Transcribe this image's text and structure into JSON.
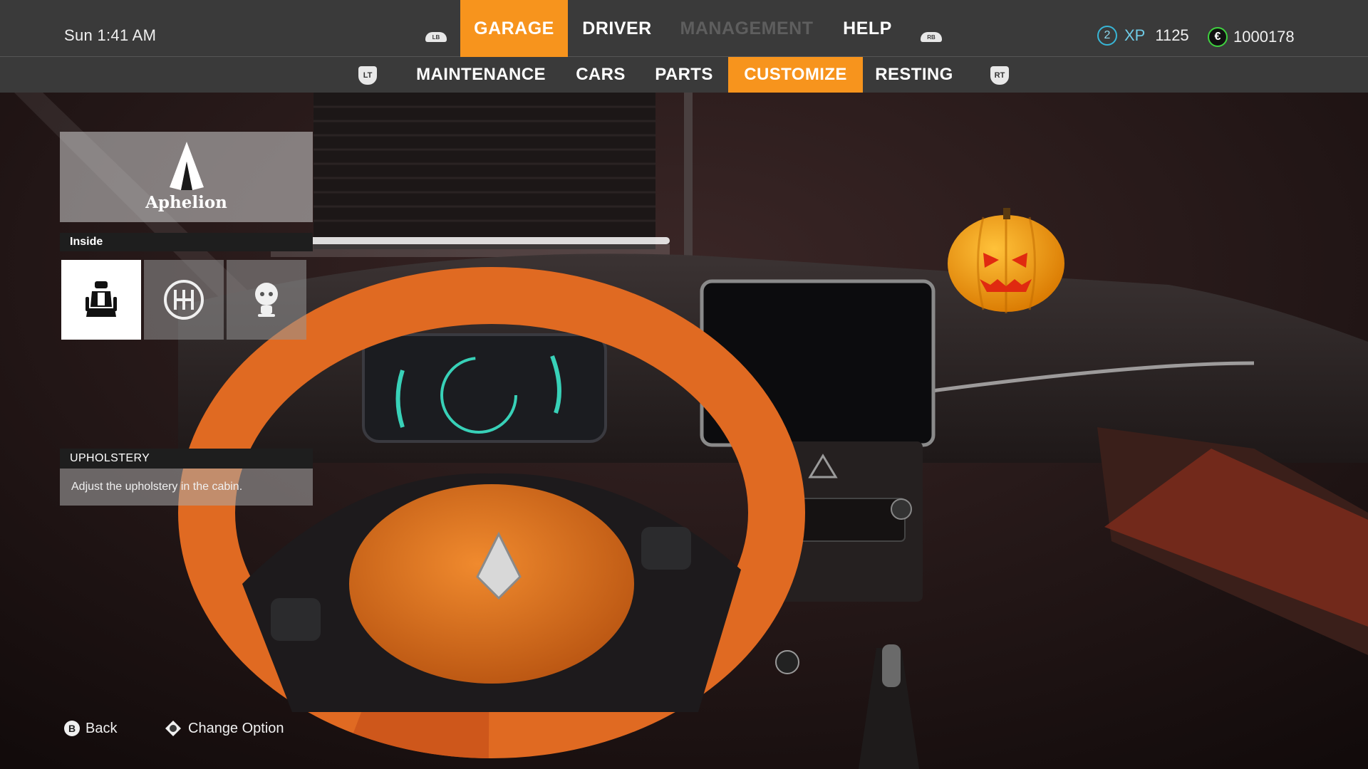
{
  "clock": "Sun  1:41 AM",
  "main_tabs": [
    {
      "label": "GARAGE",
      "state": "active"
    },
    {
      "label": "DRIVER",
      "state": "normal"
    },
    {
      "label": "MANAGEMENT",
      "state": "disabled"
    },
    {
      "label": "HELP",
      "state": "normal"
    }
  ],
  "bumpers": {
    "left": "LB",
    "right": "RB"
  },
  "sub_tabs": [
    {
      "label": "MAINTENANCE",
      "state": "normal"
    },
    {
      "label": "CARS",
      "state": "normal"
    },
    {
      "label": "PARTS",
      "state": "normal"
    },
    {
      "label": "CUSTOMIZE",
      "state": "active"
    },
    {
      "label": "RESTING",
      "state": "normal"
    }
  ],
  "triggers": {
    "left": "LT",
    "right": "RT"
  },
  "stats": {
    "level": "2",
    "xp_label": "XP",
    "xp_value": "1125",
    "currency_symbol": "€",
    "money": "1000178"
  },
  "brand": {
    "name": "Aphelion"
  },
  "inside": {
    "title": "Inside",
    "options": [
      {
        "icon": "car-seat-icon",
        "selected": true
      },
      {
        "icon": "gear-shifter-icon",
        "selected": false
      },
      {
        "icon": "bobblehead-icon",
        "selected": false
      }
    ]
  },
  "info": {
    "title": "UPHOLSTERY",
    "description": "Adjust the upholstery in the cabin."
  },
  "footer": {
    "back_key": "B",
    "back_label": "Back",
    "change_label": "Change Option"
  },
  "colors": {
    "accent": "#f7941d",
    "bar": "#3a3a3a",
    "xp": "#38b6d6",
    "money": "#3fd23f"
  }
}
